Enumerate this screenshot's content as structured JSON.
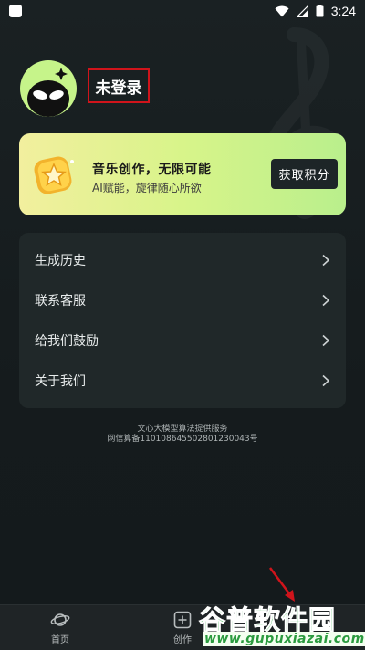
{
  "status_bar": {
    "time": "3:24",
    "icons": [
      "app-icon",
      "wifi-icon",
      "signal-icon",
      "battery-icon"
    ]
  },
  "profile": {
    "login_status": "未登录",
    "avatar_icon": "alien-avatar-icon"
  },
  "promo": {
    "title": "音乐创作，无限可能",
    "subtitle": "AI赋能，旋律随心所欲",
    "button_label": "获取积分",
    "icon": "star-coin-icon"
  },
  "menu": {
    "items": [
      {
        "label": "生成历史",
        "icon": "chevron-right-icon"
      },
      {
        "label": "联系客服",
        "icon": "chevron-right-icon"
      },
      {
        "label": "给我们鼓励",
        "icon": "chevron-right-icon"
      },
      {
        "label": "关于我们",
        "icon": "chevron-right-icon"
      }
    ]
  },
  "footer": {
    "service_line": "文心大模型算法提供服务",
    "record_line": "网信算备110108645502801230043号"
  },
  "bottom_nav": {
    "items": [
      {
        "label": "首页",
        "icon": "planet-icon"
      },
      {
        "label": "创作",
        "icon": "plus-square-icon"
      }
    ]
  },
  "watermark": {
    "name": "谷普软件园",
    "url": "www.gupuxiazai.com"
  },
  "colors": {
    "background": "#141a1c",
    "card": "#202829",
    "avatar_bg": "#c6f48a",
    "highlight_box": "#d0141b",
    "annotation_arrow": "#d0141b",
    "watermark_green": "#34b14a"
  }
}
